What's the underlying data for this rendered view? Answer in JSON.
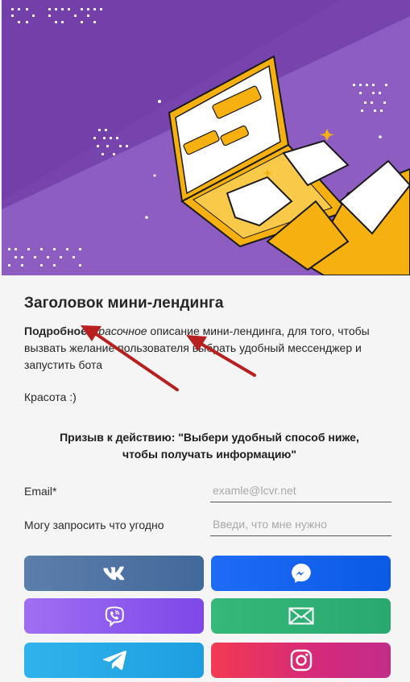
{
  "landing": {
    "title": "Заголовок мини-лендинга",
    "desc_bold": "Подробное",
    "desc_comma": ", ",
    "desc_italic": "красочное",
    "desc_rest": " описание мини-лендинга, для того, чтобы вызвать желание пользователя выбрать удобный мессенджер и запустить бота",
    "beauty": "Красота :)",
    "cta_line1": "Призыв к действию: \"Выбери удобный способ ниже,",
    "cta_line2": "чтобы получать информацию\""
  },
  "form": {
    "email_label": "Email*",
    "email_placeholder": "examle@lcvr.net",
    "custom_label": "Могу запросить что угодно",
    "custom_placeholder": "Введи, что мне нужно"
  },
  "buttons": [
    {
      "name": "vk",
      "icon": "vk-icon",
      "color": "#4f76a6"
    },
    {
      "name": "messenger",
      "icon": "messenger-icon",
      "color": "#1565f0"
    },
    {
      "name": "viber",
      "icon": "viber-icon",
      "color": "#8e5ced"
    },
    {
      "name": "email",
      "icon": "mail-icon",
      "color": "#30b175"
    },
    {
      "name": "telegram",
      "icon": "telegram-icon",
      "color": "#28aae6"
    },
    {
      "name": "instagram",
      "icon": "instagram-icon",
      "color": "#e0305f"
    }
  ],
  "hero": {
    "illustration": "robot-hands-typing-on-laptop",
    "colors": {
      "bg_dark": "#6b3aa0",
      "bg_light": "#9b6ccb",
      "accent": "#f6b110"
    }
  }
}
